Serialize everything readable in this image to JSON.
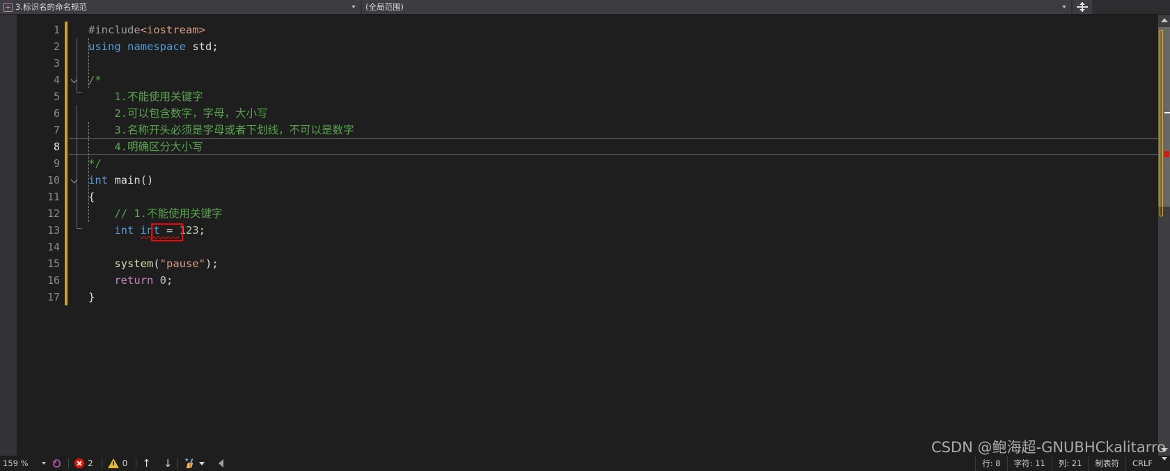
{
  "navbar": {
    "file_icon": "cpp-file-icon",
    "file_label": "3.标识名的命名规范",
    "scope_label": "(全局范围)",
    "split_icon": "split-view-icon",
    "caret_icon": "chevron-down-icon"
  },
  "editor": {
    "line_numbers": [
      "1",
      "2",
      "3",
      "4",
      "5",
      "6",
      "7",
      "8",
      "9",
      "10",
      "11",
      "12",
      "13",
      "14",
      "15",
      "16",
      "17"
    ],
    "current_line": 8,
    "lines": [
      {
        "n": 1,
        "text": "#include<iostream>"
      },
      {
        "n": 2,
        "text": "using namespace std;"
      },
      {
        "n": 3,
        "text": ""
      },
      {
        "n": 4,
        "text": "/*"
      },
      {
        "n": 5,
        "text": "    1.不能使用关键字"
      },
      {
        "n": 6,
        "text": "    2.可以包含数字，字母，大小写"
      },
      {
        "n": 7,
        "text": "    3.名称开头必须是字母或者下划线，不可以是数字"
      },
      {
        "n": 8,
        "text": "    4.明确区分大小写"
      },
      {
        "n": 9,
        "text": "*/"
      },
      {
        "n": 10,
        "text": "int main()"
      },
      {
        "n": 11,
        "text": "{"
      },
      {
        "n": 12,
        "text": "    // 1.不能使用关键字"
      },
      {
        "n": 13,
        "text": "    int int = 123;"
      },
      {
        "n": 14,
        "text": ""
      },
      {
        "n": 15,
        "text": "    system(\"pause\");"
      },
      {
        "n": 16,
        "text": "    return 0;"
      },
      {
        "n": 17,
        "text": "}"
      }
    ],
    "tokens": {
      "l1_hash_include": "#include",
      "l1_header": "<iostream>",
      "l2_using": "using",
      "l2_namespace": "namespace",
      "l2_std": " std;",
      "l4_open_comment": "/*",
      "l5_comment": "1.不能使用关键字",
      "l6_comment": "2.可以包含数字，字母，大小写",
      "l7_comment": "3.名称开头必须是字母或者下划线，不可以是数字",
      "l8_comment": "4.明确区分大小写",
      "l9_close_comment": "*/",
      "l10_int": "int",
      "l10_main": " main",
      "l10_parens": "()",
      "l11_brace_open": "{",
      "l12_comment": "// 1.不能使用关键字",
      "l13_int_type": "int ",
      "l13_int_name": "int",
      "l13_assign": " = ",
      "l13_value": "123",
      "l13_semi": ";",
      "l15_system": "system",
      "l15_paren_open": "(",
      "l15_pause": "\"pause\"",
      "l15_paren_close": ")",
      "l15_semi": ";",
      "l16_return": "return",
      "l16_zero": " 0",
      "l16_semi": ";",
      "l17_brace_close": "}"
    }
  },
  "scrollbar": {
    "up_arrow_icon": "chevron-up-icon",
    "down_arrow_icon": "chevron-down-icon",
    "change_marker_color": "#d6b338",
    "error_marker_color": "#e51400",
    "caret_marker_color": "#ffffff"
  },
  "statusbar": {
    "zoom_level": "159 %",
    "zoom_caret_icon": "chevron-down-icon",
    "intellicode_icon": "intellicode-head-icon",
    "error_icon": "error-circle-icon",
    "error_count": "2",
    "warning_icon": "warning-triangle-icon",
    "warning_count": "0",
    "prev_icon": "arrow-up-icon",
    "prev_glyph": "↑",
    "next_icon": "arrow-down-icon",
    "next_glyph": "↓",
    "cleanup_icon": "broom-icon",
    "cleanup_caret_icon": "chevron-down-icon",
    "scroll_left_icon": "triangle-left-icon",
    "row_label": "行: 8",
    "char_label": "字符: 11",
    "col_label": "列: 21",
    "tab_label": "制表符",
    "eol_label": "CRLF",
    "overflow_caret_icon": "chevron-down-icon"
  },
  "watermark": {
    "text": "CSDN @鲍海超-GNUBHCkalitarro"
  },
  "colors": {
    "editor_bg": "#1e1e1e",
    "chrome_bg": "#2d2d30",
    "gutter_bg": "#333337",
    "comment_green": "#57a64a",
    "keyword_blue": "#569cd6",
    "string_salmon": "#d69d85",
    "func_yellow": "#dcdcaa",
    "return_purple": "#c586c0",
    "number_green": "#b5cea8",
    "error_red": "#e51400",
    "annotation_red": "#ff0000",
    "change_yellow": "#c9a227"
  }
}
